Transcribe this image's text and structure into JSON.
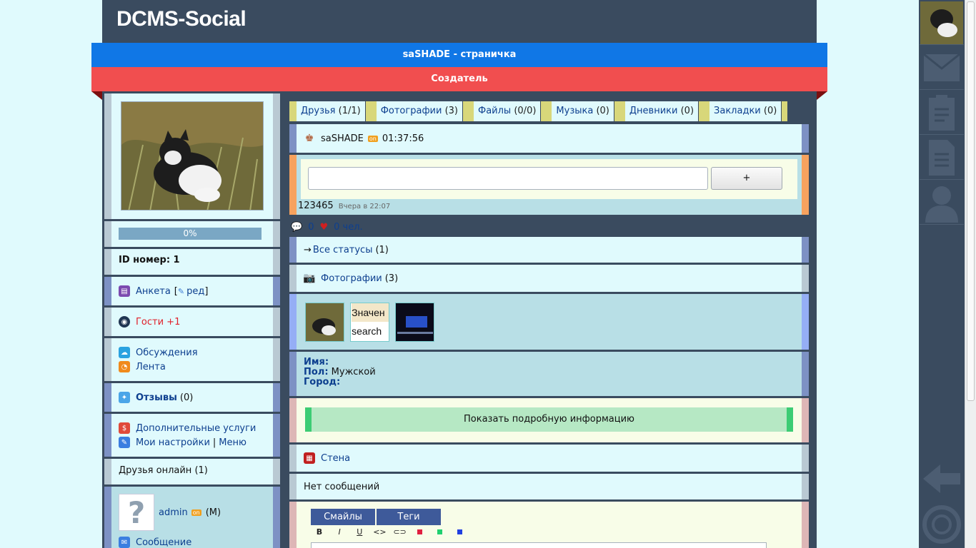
{
  "site": {
    "logo": "DCMS-Social"
  },
  "banner": {
    "title": "saSHADE - страничка",
    "role": "Создатель"
  },
  "left": {
    "progress": "0%",
    "id_label": "ID номер: 1",
    "anketa": "Анкета",
    "anketa_bracket": "[",
    "anketa_edit": "ред",
    "anketa_close": "]",
    "guests": "Гости +1",
    "discussions": "Обсуждения",
    "feed": "Лента",
    "reviews": "Отзывы",
    "reviews_count": "(0)",
    "extra_services": "Дополнительные услуги",
    "my_settings": "Мои настройки",
    "separator": "|",
    "menu": "Меню",
    "friends_online": "Друзья онлайн (1)",
    "friend": {
      "name": "admin",
      "online": "on",
      "gender": "(М)",
      "message": "Сообщение",
      "avatar_glyph": "?"
    }
  },
  "tabs": [
    {
      "label": "Друзья",
      "count": "(1/1)"
    },
    {
      "label": "Фотографии",
      "count": "(3)"
    },
    {
      "label": "Файлы",
      "count": "(0/0)"
    },
    {
      "label": "Музыка",
      "count": "(0)"
    },
    {
      "label": "Дневники",
      "count": "(0)"
    },
    {
      "label": "Закладки",
      "count": "(0)"
    }
  ],
  "user": {
    "name": "saSHADE",
    "online": "on",
    "time": "01:37:56"
  },
  "status": {
    "plus_label": "+",
    "text": "123465",
    "date": "Вчера в 22:07",
    "comments": "0",
    "likes": "0 чел."
  },
  "all_statuses": {
    "arrow": "→",
    "label": "Все статусы",
    "count": "(1)"
  },
  "photos": {
    "label": "Фотографии",
    "count": "(3)",
    "thumb2_top": "Значен",
    "thumb2_bottom": "search"
  },
  "info": {
    "name_label": "Имя:",
    "gender_label": "Пол:",
    "gender_value": "Мужской",
    "city_label": "Город:"
  },
  "show_more": "Показать подробную информацию",
  "wall": {
    "label": "Стена",
    "empty": "Нет сообщений"
  },
  "editor": {
    "smiles": "Смайлы",
    "tags": "Теги",
    "format": [
      "B",
      "I",
      "U",
      "<>",
      "⊂⊃"
    ]
  },
  "colors": {
    "header": "#3a4b5f",
    "blue_bar": "#1077e6",
    "red_bar": "#f14e4f",
    "link": "#0d3f8f",
    "guest": "#e0202a"
  }
}
